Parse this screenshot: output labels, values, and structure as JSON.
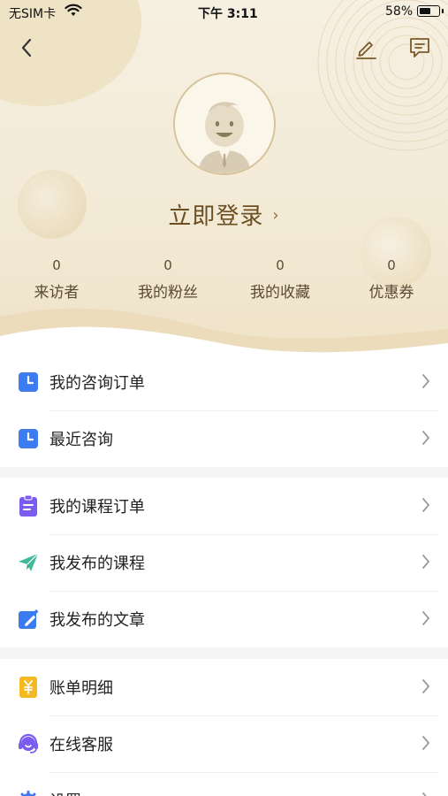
{
  "status_bar": {
    "carrier": "无SIM卡",
    "time": "下午 3:11",
    "battery": "58%",
    "battery_level": 0.58
  },
  "nav": {
    "back_icon": "chevron-left-icon",
    "edit_icon": "pencil-icon",
    "message_icon": "message-icon"
  },
  "profile": {
    "login_text": "立即登录",
    "stats": [
      {
        "value": "0",
        "label": "来访者"
      },
      {
        "value": "0",
        "label": "我的粉丝"
      },
      {
        "value": "0",
        "label": "我的收藏"
      },
      {
        "value": "0",
        "label": "优惠券"
      }
    ]
  },
  "sections": [
    {
      "items": [
        {
          "label": "我的咨询订单",
          "icon": "clock-icon",
          "color": "#3d7bf0"
        },
        {
          "label": "最近咨询",
          "icon": "clock-icon",
          "color": "#3d7bf0"
        }
      ]
    },
    {
      "items": [
        {
          "label": "我的课程订单",
          "icon": "clipboard-icon",
          "color": "#7b5cf0"
        },
        {
          "label": "我发布的课程",
          "icon": "paper-plane-icon",
          "color": "#3fb99a"
        },
        {
          "label": "我发布的文章",
          "icon": "edit-square-icon",
          "color": "#3a7cf0"
        }
      ]
    },
    {
      "items": [
        {
          "label": "账单明细",
          "icon": "yen-bill-icon",
          "color": "#f5b922"
        },
        {
          "label": "在线客服",
          "icon": "headset-icon",
          "color": "#7b5cf0"
        },
        {
          "label": "设置",
          "icon": "gear-icon",
          "color": "#3d7bf0"
        }
      ]
    }
  ]
}
